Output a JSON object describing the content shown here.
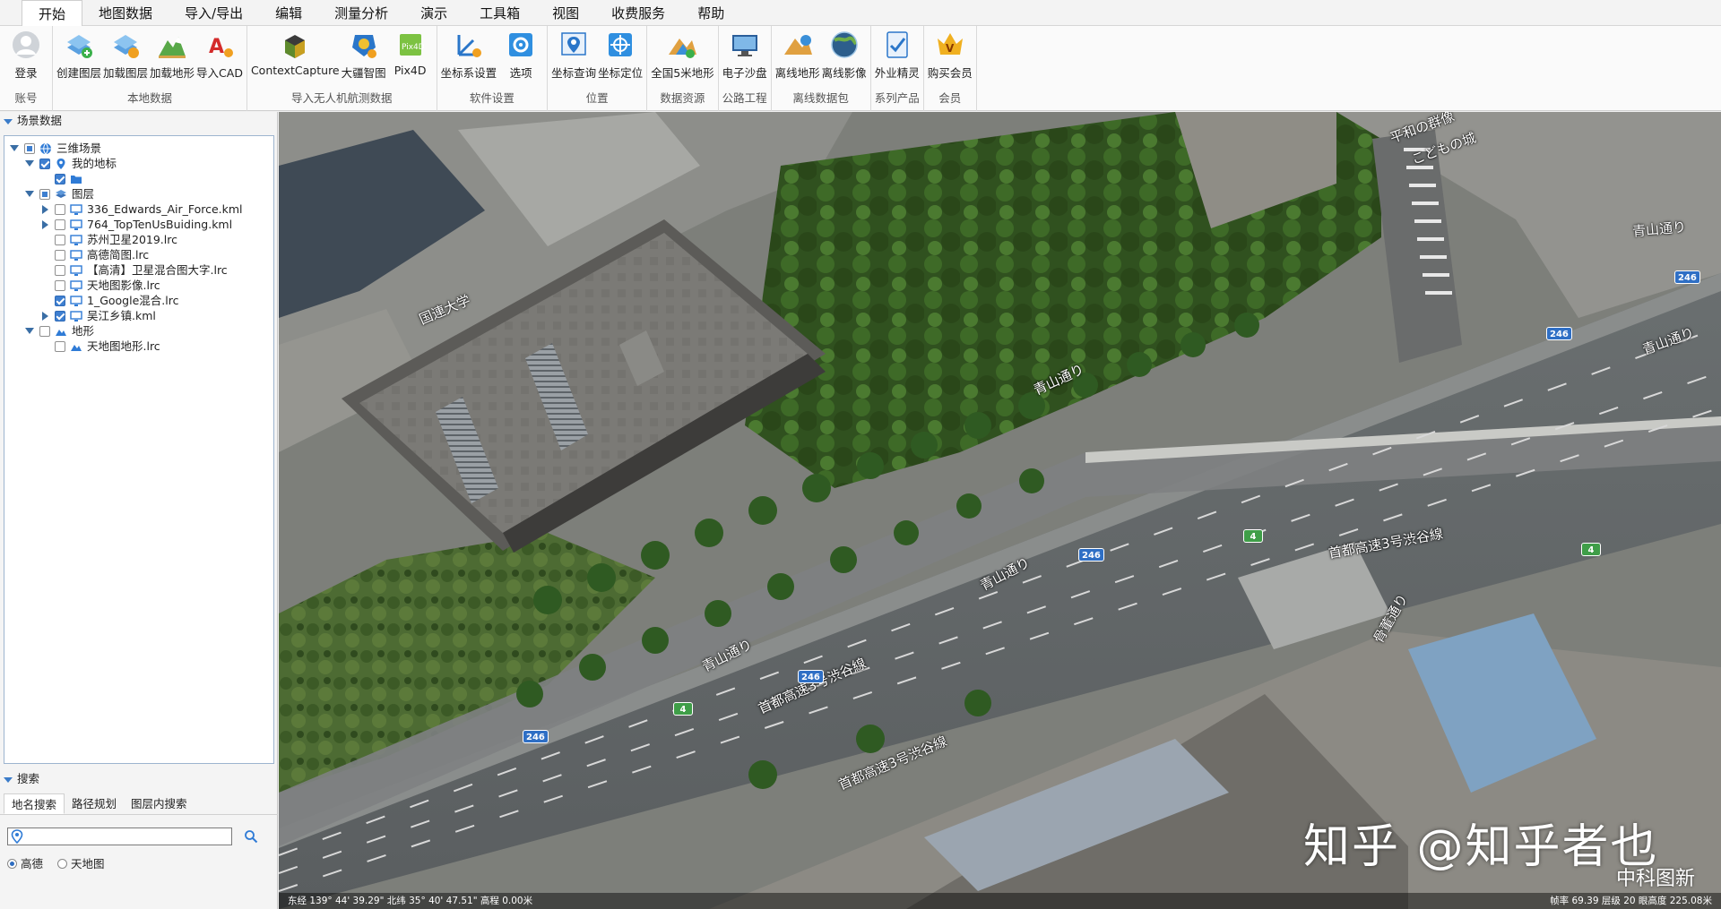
{
  "tabs": [
    "开始",
    "地图数据",
    "导入/导出",
    "编辑",
    "测量分析",
    "演示",
    "工具箱",
    "视图",
    "收费服务",
    "帮助"
  ],
  "ribbon": {
    "groups": [
      {
        "label": "账号",
        "buttons": [
          {
            "label": "登录",
            "icon": "user-icon"
          }
        ]
      },
      {
        "label": "本地数据",
        "buttons": [
          {
            "label": "创建图层",
            "icon": "create-layer-icon"
          },
          {
            "label": "加载图层",
            "icon": "load-layer-icon"
          },
          {
            "label": "加载地形",
            "icon": "load-terrain-icon"
          },
          {
            "label": "导入CAD",
            "icon": "import-cad-icon"
          }
        ]
      },
      {
        "label": "导入无人机航测数据",
        "buttons": [
          {
            "label": "ContextCapture",
            "icon": "contextcapture-icon"
          },
          {
            "label": "大疆智图",
            "icon": "dji-terra-icon"
          },
          {
            "label": "Pix4D",
            "icon": "pix4d-icon"
          }
        ]
      },
      {
        "label": "软件设置",
        "buttons": [
          {
            "label": "坐标系设置",
            "icon": "coordinate-system-icon"
          },
          {
            "label": "选项",
            "icon": "options-gear-icon"
          }
        ]
      },
      {
        "label": "位置",
        "buttons": [
          {
            "label": "坐标查询",
            "icon": "coordinate-query-icon"
          },
          {
            "label": "坐标定位",
            "icon": "coordinate-locate-icon"
          }
        ]
      },
      {
        "label": "数据资源",
        "buttons": [
          {
            "label": "全国5米地形",
            "icon": "terrain-5m-icon"
          }
        ]
      },
      {
        "label": "公路工程",
        "buttons": [
          {
            "label": "电子沙盘",
            "icon": "electronic-sandbox-icon"
          }
        ]
      },
      {
        "label": "离线数据包",
        "buttons": [
          {
            "label": "离线地形",
            "icon": "offline-terrain-icon"
          },
          {
            "label": "离线影像",
            "icon": "offline-imagery-icon"
          }
        ]
      },
      {
        "label": "系列产品",
        "buttons": [
          {
            "label": "外业精灵",
            "icon": "field-app-icon"
          }
        ]
      },
      {
        "label": "会员",
        "buttons": [
          {
            "label": "购买会员",
            "icon": "buy-membership-icon"
          }
        ]
      }
    ]
  },
  "scene_panel": {
    "title": "场景数据",
    "tree": [
      {
        "label": "三维场景",
        "depth": 0,
        "expand": "open",
        "check": "partial",
        "icon": "globe-icon"
      },
      {
        "label": "我的地标",
        "depth": 1,
        "expand": "open",
        "check": "checked",
        "icon": "placemark-icon"
      },
      {
        "label": "",
        "depth": 2,
        "expand": "",
        "check": "checked",
        "icon": "folder-icon"
      },
      {
        "label": "图层",
        "depth": 1,
        "expand": "open",
        "check": "partial",
        "icon": "layers-icon"
      },
      {
        "label": "336_Edwards_Air_Force.kml",
        "depth": 2,
        "expand": "closed",
        "check": "unchecked",
        "icon": "monitor-icon"
      },
      {
        "label": "764_TopTenUsBuiding.kml",
        "depth": 2,
        "expand": "closed",
        "check": "unchecked",
        "icon": "monitor-icon"
      },
      {
        "label": "苏州卫星2019.lrc",
        "depth": 2,
        "expand": "",
        "check": "unchecked",
        "icon": "monitor-icon"
      },
      {
        "label": "高德简图.lrc",
        "depth": 2,
        "expand": "",
        "check": "unchecked",
        "icon": "monitor-icon"
      },
      {
        "label": "【高清】卫星混合图大字.lrc",
        "depth": 2,
        "expand": "",
        "check": "unchecked",
        "icon": "monitor-icon"
      },
      {
        "label": "天地图影像.lrc",
        "depth": 2,
        "expand": "",
        "check": "unchecked",
        "icon": "monitor-icon"
      },
      {
        "label": "1_Google混合.lrc",
        "depth": 2,
        "expand": "",
        "check": "checked",
        "icon": "monitor-icon"
      },
      {
        "label": "吴江乡镇.kml",
        "depth": 2,
        "expand": "closed",
        "check": "checked",
        "icon": "monitor-icon"
      },
      {
        "label": "地形",
        "depth": 1,
        "expand": "open",
        "check": "unchecked",
        "icon": "terrain-icon"
      },
      {
        "label": "天地图地形.lrc",
        "depth": 2,
        "expand": "",
        "check": "unchecked",
        "icon": "terrain-icon"
      }
    ]
  },
  "search_panel": {
    "title": "搜索",
    "tabs": [
      "地名搜索",
      "路径规划",
      "图层内搜索"
    ],
    "input_value": "",
    "input_placeholder": "",
    "sources": [
      {
        "label": "高德",
        "selected": true
      },
      {
        "label": "天地图",
        "selected": false
      }
    ]
  },
  "map": {
    "labels": [
      "平和の群像",
      "こどもの城",
      "青山通り",
      "青山通り",
      "青山通り",
      "青山通り",
      "首都高速3号渋谷線",
      "首都高速3号渋谷線",
      "首都高速3号渋谷線",
      "国連大学",
      "骨董通り",
      "青山通り"
    ],
    "route_shields": [
      "246",
      "246",
      "246",
      "246",
      "246",
      "4",
      "4",
      "4"
    ],
    "watermark": "知乎 @知乎者也",
    "watermark2": "中科图新",
    "status_left": "东经 139° 44' 39.29\" 北纬 35° 40' 47.51\" 高程 0.00米",
    "status_right": "帧率 69.39  层级 20  眼高度 225.08米"
  }
}
